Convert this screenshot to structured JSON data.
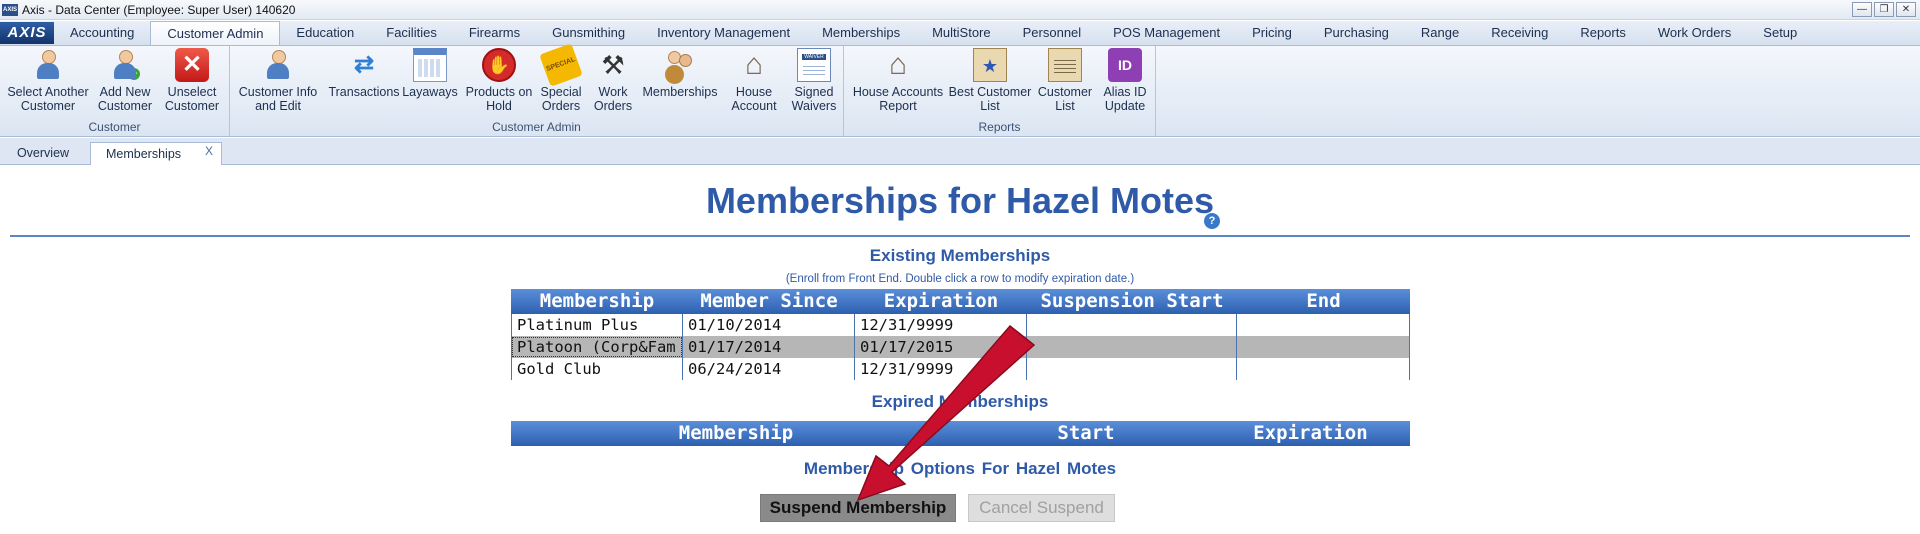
{
  "window": {
    "app_icon": "AXIS",
    "title": "Axis - Data Center  (Employee: Super User) 140620",
    "buttons": [
      "—",
      "❐",
      "✕"
    ]
  },
  "menu": {
    "logo": "AXIS",
    "tabs": [
      "Accounting",
      "Customer Admin",
      "Education",
      "Facilities",
      "Firearms",
      "Gunsmithing",
      "Inventory Management",
      "Memberships",
      "MultiStore",
      "Personnel",
      "POS Management",
      "Pricing",
      "Purchasing",
      "Range",
      "Receiving",
      "Reports",
      "Work Orders",
      "Setup"
    ],
    "active_tab": "Customer Admin"
  },
  "ribbon": {
    "groups": [
      {
        "label": "Customer",
        "buttons": [
          "Select Another\nCustomer",
          "Add New\nCustomer",
          "Unselect\nCustomer"
        ]
      },
      {
        "label": "Customer Admin",
        "buttons": [
          "Customer Info\nand Edit",
          "Transactions",
          "Layaways",
          "Products on\nHold",
          "Special\nOrders",
          "Work\nOrders",
          "Memberships",
          "House\nAccount",
          "Signed\nWaivers"
        ]
      },
      {
        "label": "Reports",
        "buttons": [
          "House Accounts\nReport",
          "Best Customer\nList",
          "Customer\nList",
          "Alias ID\nUpdate"
        ]
      }
    ],
    "icon_text": {
      "stop": "✋",
      "special": "SPECIAL",
      "waiver": "WAIVER",
      "alias": "ID",
      "add": "+",
      "x": "✕",
      "transactions": "⇄",
      "tools": "⚒",
      "house": "⌂",
      "star": "★"
    }
  },
  "doc_tabs": {
    "tabs": [
      "Overview",
      "Memberships"
    ],
    "active": "Memberships",
    "close": "X"
  },
  "page": {
    "title": "Memberships for Hazel Motes",
    "help": "?",
    "existing_header": "Existing Memberships",
    "existing_note": "(Enroll from Front End. Double click a row to modify expiration date.)",
    "existing_columns": [
      "Membership",
      "Member Since",
      "Expiration",
      "Suspension Start",
      "End"
    ],
    "existing_rows": [
      [
        "Platinum Plus",
        "01/10/2014",
        "12/31/9999",
        "",
        ""
      ],
      [
        "Platoon (Corp&Fam",
        "01/17/2014",
        "01/17/2015",
        "",
        ""
      ],
      [
        "Gold Club",
        "06/24/2014",
        "12/31/9999",
        "",
        ""
      ]
    ],
    "selected_row": 1,
    "expired_header": "Expired Memberships",
    "expired_columns": [
      "Membership",
      "Start",
      "Expiration"
    ],
    "options_label": "Membership Options For  Hazel Motes",
    "suspend_button": "Suspend Membership",
    "cancel_button": "Cancel Suspend"
  },
  "colors": {
    "accent": "#2f5aa8",
    "header_bar": "#2d5fb0",
    "arrow": "#c8102e",
    "selected_row": "#b6b6b6"
  }
}
